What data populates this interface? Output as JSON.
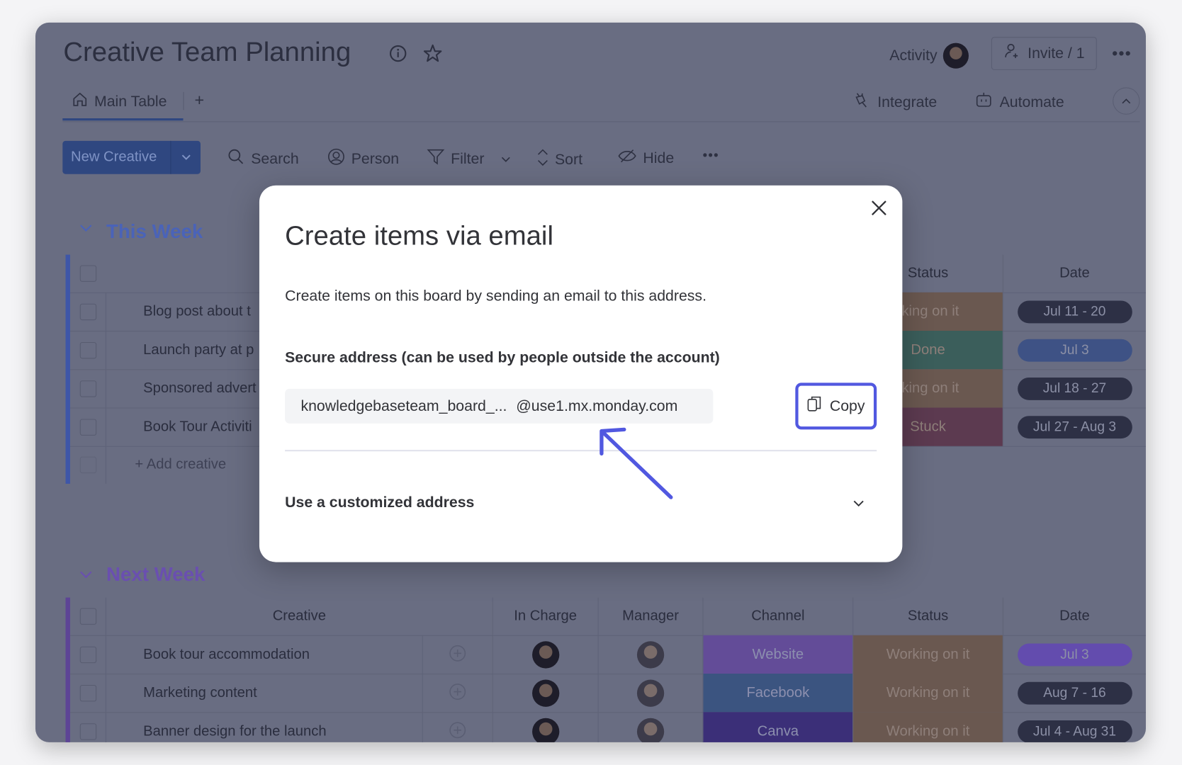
{
  "board": {
    "title": "Creative Team Planning",
    "activity_label": "Activity",
    "invite_label": "Invite / 1"
  },
  "tabs": {
    "main": "Main Table",
    "add": "+",
    "integrate": "Integrate",
    "automate": "Automate"
  },
  "toolbar": {
    "new_item": "New Creative",
    "search": "Search",
    "person": "Person",
    "filter": "Filter",
    "sort": "Sort",
    "hide": "Hide"
  },
  "groups": [
    {
      "title": "This Week",
      "color": "#4a63b8",
      "columns": {
        "status": "Status",
        "date": "Date"
      },
      "rows": [
        {
          "name": "Blog post about t",
          "status": "rking on it",
          "status_color": "#6a5850",
          "date": "Jul 11 - 20",
          "date_color": "#2d3045"
        },
        {
          "name": "Launch party at p",
          "status": "Done",
          "status_color": "#3b5e5b",
          "date": "Jul 3",
          "date_color": "#3e5285"
        },
        {
          "name": "Sponsored advert",
          "status": "rking on it",
          "status_color": "#6a5850",
          "date": "Jul 18 - 27",
          "date_color": "#2d3045"
        },
        {
          "name": "Book Tour Activiti",
          "status": "Stuck",
          "status_color": "#5c3a50",
          "date": "Jul 27 - Aug 3",
          "date_color": "#2d3045"
        }
      ],
      "add_label": "+ Add creative"
    },
    {
      "title": "Next Week",
      "color": "#6a4fb0",
      "columns": {
        "creative": "Creative",
        "in_charge": "In Charge",
        "manager": "Manager",
        "channel": "Channel",
        "status": "Status",
        "date": "Date"
      },
      "rows": [
        {
          "name": "Book tour accommodation",
          "channel": "Website",
          "channel_color": "#634c98",
          "status": "Working on it",
          "status_color": "#6a5850",
          "date": "Jul 3",
          "date_color": "#634cae"
        },
        {
          "name": "Marketing content",
          "channel": "Facebook",
          "channel_color": "#3b5480",
          "status": "Working on it",
          "status_color": "#6a5850",
          "date": "Aug 7 - 16",
          "date_color": "#2d3045"
        },
        {
          "name": "Banner design for the launch",
          "channel": "Canva",
          "channel_color": "#3b2f78",
          "status": "Working on it",
          "status_color": "#6a5850",
          "date": "Jul 4 - Aug 31",
          "date_color": "#2d3045"
        }
      ]
    }
  ],
  "modal": {
    "title": "Create items via email",
    "description": "Create items on this board by sending an email to this address.",
    "secure_heading": "Secure address (can be used by people outside the account)",
    "address_prefix": "knowledgebaseteam_board_...",
    "address_domain": "@use1.mx.monday.com",
    "copy_label": "Copy",
    "custom_heading": "Use a customized address",
    "highlight_color": "#5158e0"
  }
}
